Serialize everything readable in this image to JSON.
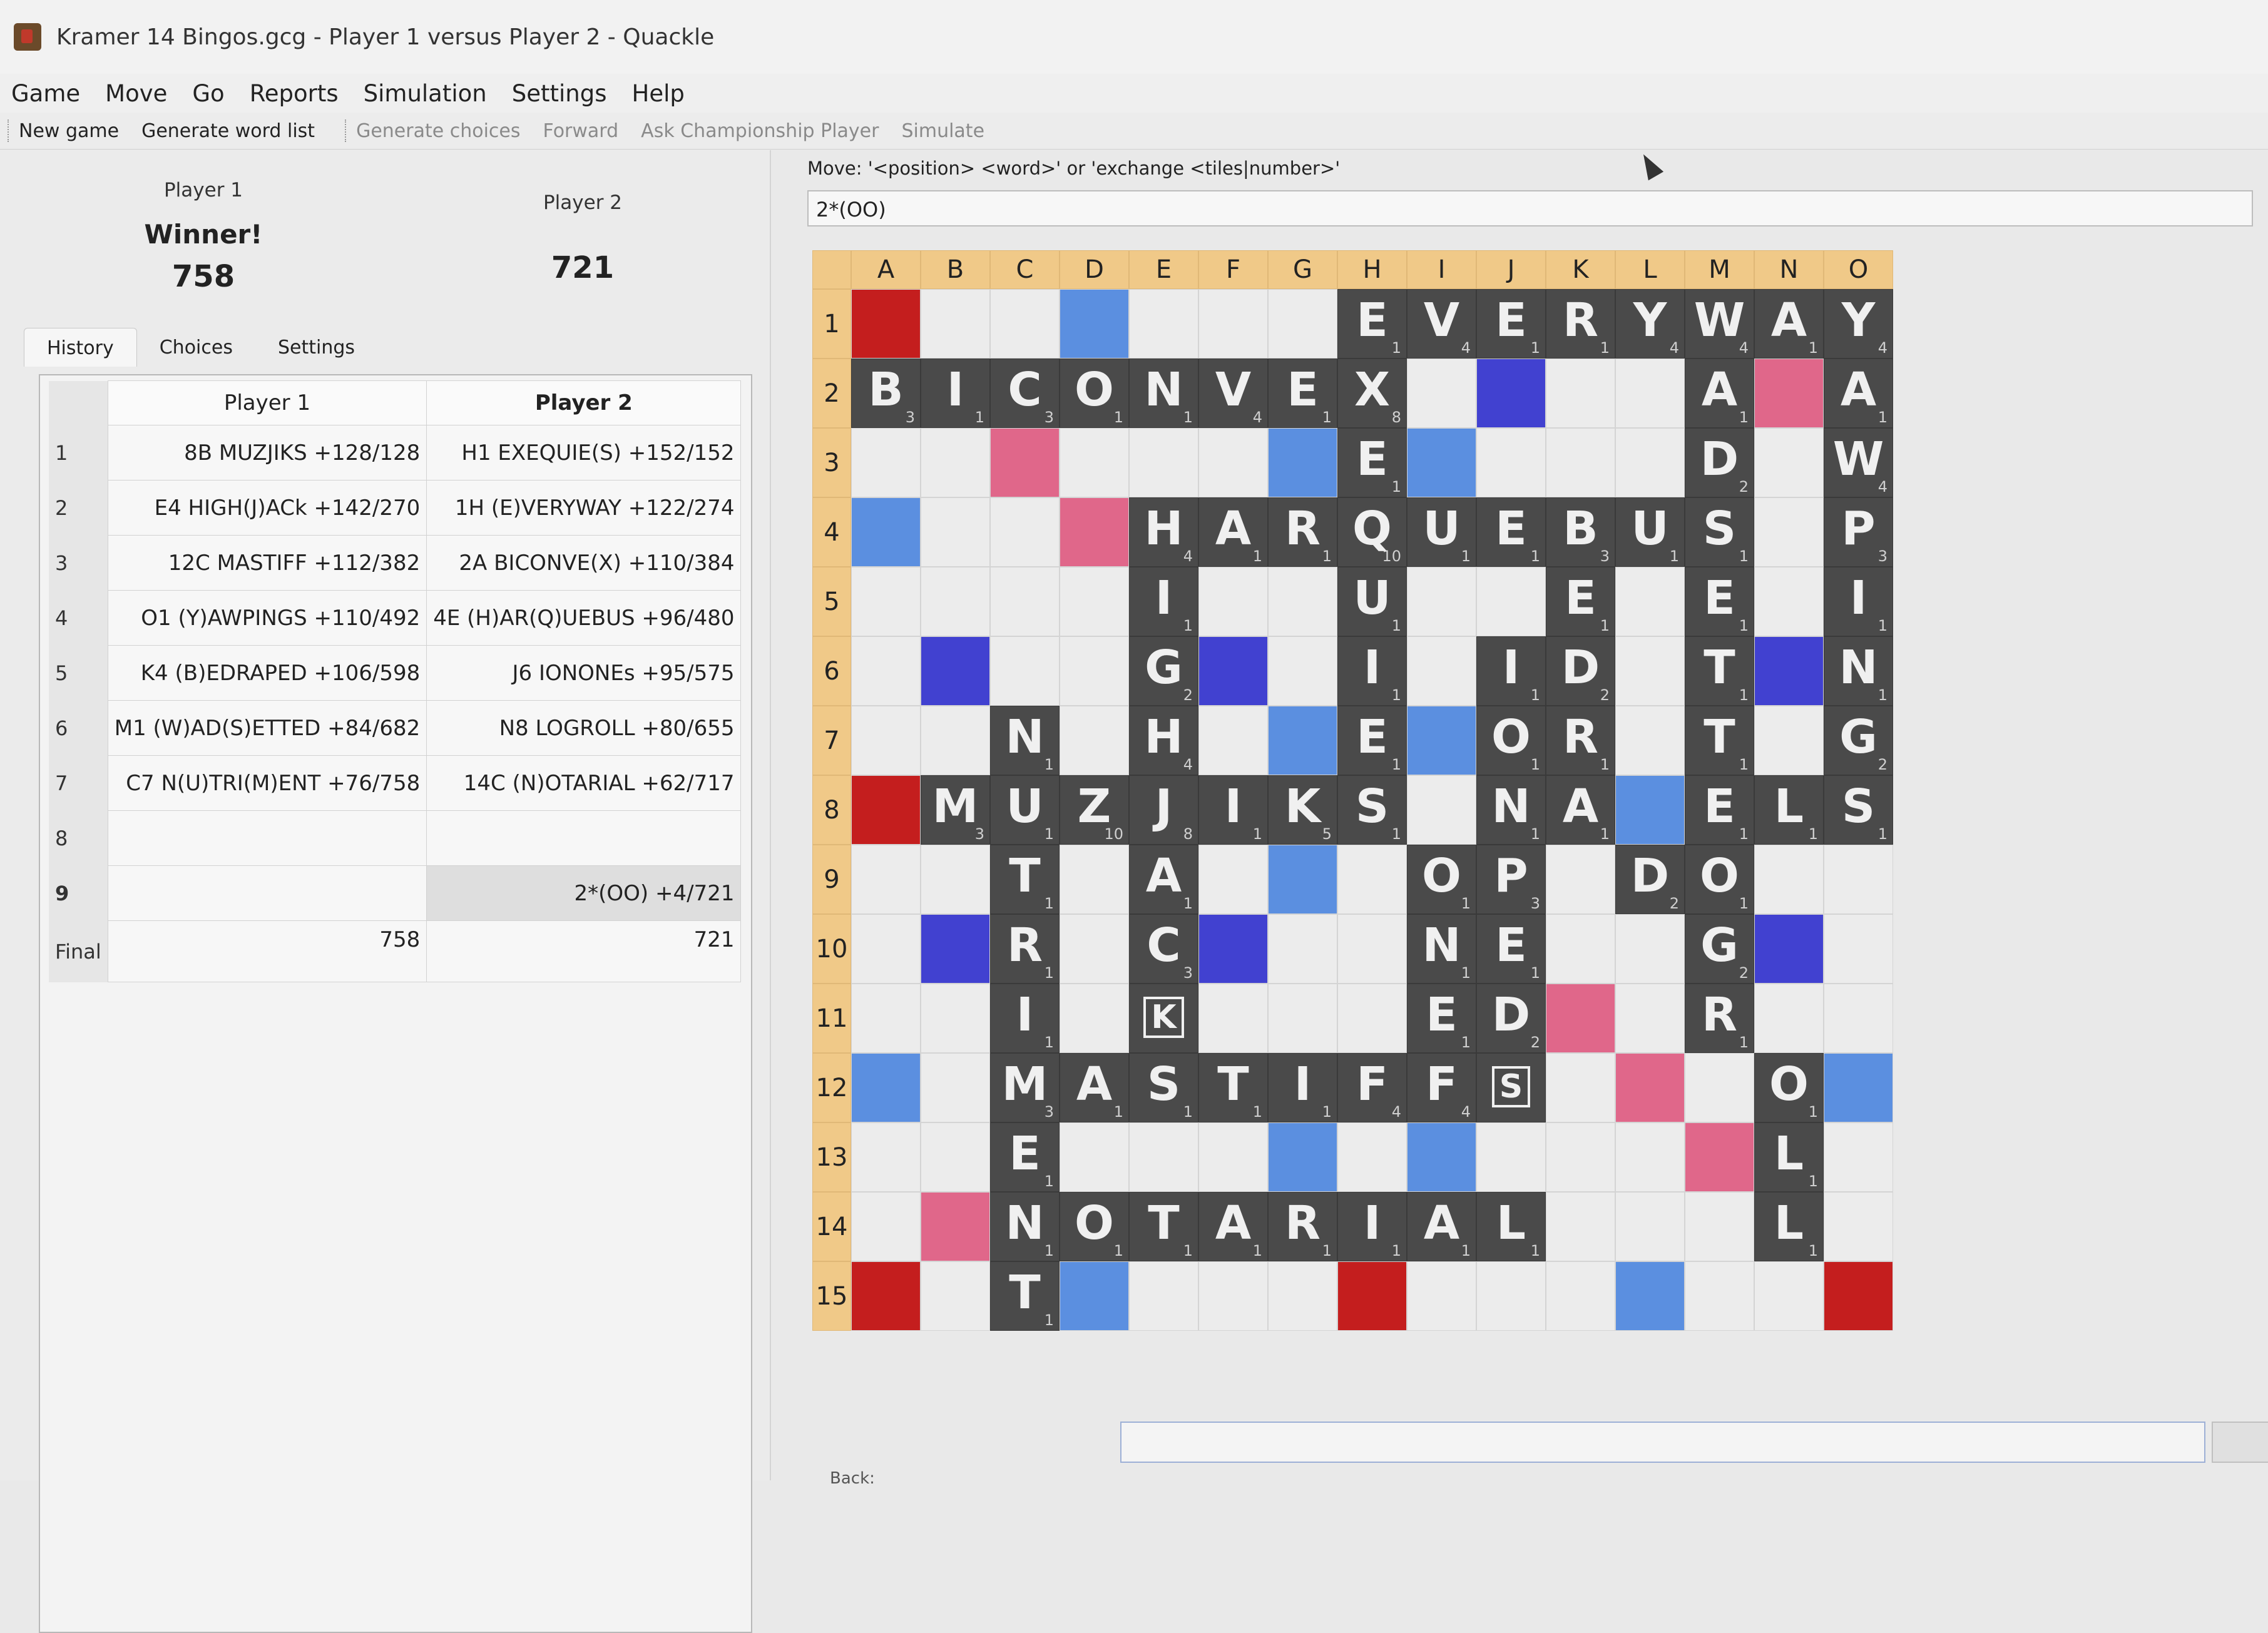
{
  "window": {
    "title": "Kramer 14 Bingos.gcg - Player 1 versus Player 2 - Quackle"
  },
  "menu": [
    "Game",
    "Move",
    "Go",
    "Reports",
    "Simulation",
    "Settings",
    "Help"
  ],
  "toolbar": {
    "new_game": "New game",
    "generate_word_list": "Generate word list",
    "generate_choices": "Generate choices",
    "forward": "Forward",
    "ask_championship": "Ask Championship Player",
    "simulate": "Simulate"
  },
  "players": {
    "p1_name": "Player 1",
    "p1_score": "758",
    "p2_name": "Player 2",
    "p2_score": "721",
    "winner_label": "Winner!"
  },
  "tabs": [
    "History",
    "Choices",
    "Settings"
  ],
  "history": {
    "col1": "Player 1",
    "col2": "Player 2",
    "rows": [
      {
        "n": "1",
        "p1": "8B MUZJIKS +128/128",
        "p2": "H1 EXEQUIE(S) +152/152"
      },
      {
        "n": "2",
        "p1": "E4 HIGH(J)ACk +142/270",
        "p2": "1H (E)VERYWAY +122/274"
      },
      {
        "n": "3",
        "p1": "12C MASTIFF +112/382",
        "p2": "2A BICONVE(X) +110/384"
      },
      {
        "n": "4",
        "p1": "O1 (Y)AWPINGS +110/492",
        "p2": "4E (H)AR(Q)UEBUS +96/480"
      },
      {
        "n": "5",
        "p1": "K4 (B)EDRAPED +106/598",
        "p2": "J6 IONONEs +95/575"
      },
      {
        "n": "6",
        "p1": "M1 (W)AD(S)ETTED +84/682",
        "p2": "N8 LOGROLL +80/655"
      },
      {
        "n": "7",
        "p1": "C7 N(U)TRI(M)ENT +76/758",
        "p2": "14C (N)OTARIAL +62/717"
      },
      {
        "n": "8",
        "p1": "",
        "p2": ""
      },
      {
        "n": "9",
        "p1": "",
        "p2": "2*(OO) +4/721"
      }
    ],
    "final_label": "Final",
    "final_p1": "758",
    "final_p2": "721"
  },
  "move_entry": {
    "label": "Move: '<position> <word>' or 'exchange <tiles|number>'",
    "value": "2*(OO)"
  },
  "board": {
    "columns": [
      "A",
      "B",
      "C",
      "D",
      "E",
      "F",
      "G",
      "H",
      "I",
      "J",
      "K",
      "L",
      "M",
      "N",
      "O"
    ],
    "rows": [
      "1",
      "2",
      "3",
      "4",
      "5",
      "6",
      "7",
      "8",
      "9",
      "10",
      "11",
      "12",
      "13",
      "14",
      "15"
    ],
    "premium_layout": [
      "TW . . DL . . . TW . . . DL . . TW",
      ". DW . . . TL . . . TL . . . DW .",
      ". . DW . . . DL . DL . . . DW . .",
      "DL . . DW . . . DL . . . DW . . DL",
      ". . . . DW . . . . . DW . . . .",
      ". TL . . . TL . . . TL . . . TL .",
      ". . DL . . . DL . DL . . . DL . .",
      "TW . . DL . . . DW . . . DL . . TW",
      ". . DL . . . DL . DL . . . DL . .",
      ". TL . . . TL . . . TL . . . TL .",
      ". . . . DW . . . . . DW . . . .",
      "DL . . DW . . . DL . . . DW . . DL",
      ". . DW . . . DL . DL . . . DW . .",
      ". DW . . . TL . . . TL . . . DW .",
      "TW . . DL . . . TW . . . DL . . TW"
    ],
    "tiles": [
      "_______EVERYWAY",
      "BICONVEX____A_A",
      "_______E____D_W",
      "____HARQUEBUS_P",
      "____I__U__E_E_I",
      "____G__I_ID_T_N",
      "__N_H__E_OR_T_G",
      "_MUZJIKS_NA_ELS",
      "__T_A___OP_DO",
      "__R_C___NE__G",
      "__I_k___ED__R",
      "__MASTIFFs___O",
      "__E__________L",
      "__NOTARIAL___L",
      "__T"
    ],
    "letter_points": {
      "A": 1,
      "B": 3,
      "C": 3,
      "D": 2,
      "E": 1,
      "F": 4,
      "G": 2,
      "H": 4,
      "I": 1,
      "J": 8,
      "K": 5,
      "L": 1,
      "M": 3,
      "N": 1,
      "O": 1,
      "P": 3,
      "Q": 10,
      "R": 1,
      "S": 1,
      "T": 1,
      "U": 1,
      "V": 4,
      "W": 4,
      "X": 8,
      "Y": 4,
      "Z": 10
    }
  },
  "bottom": {
    "back_label": "Back:"
  }
}
